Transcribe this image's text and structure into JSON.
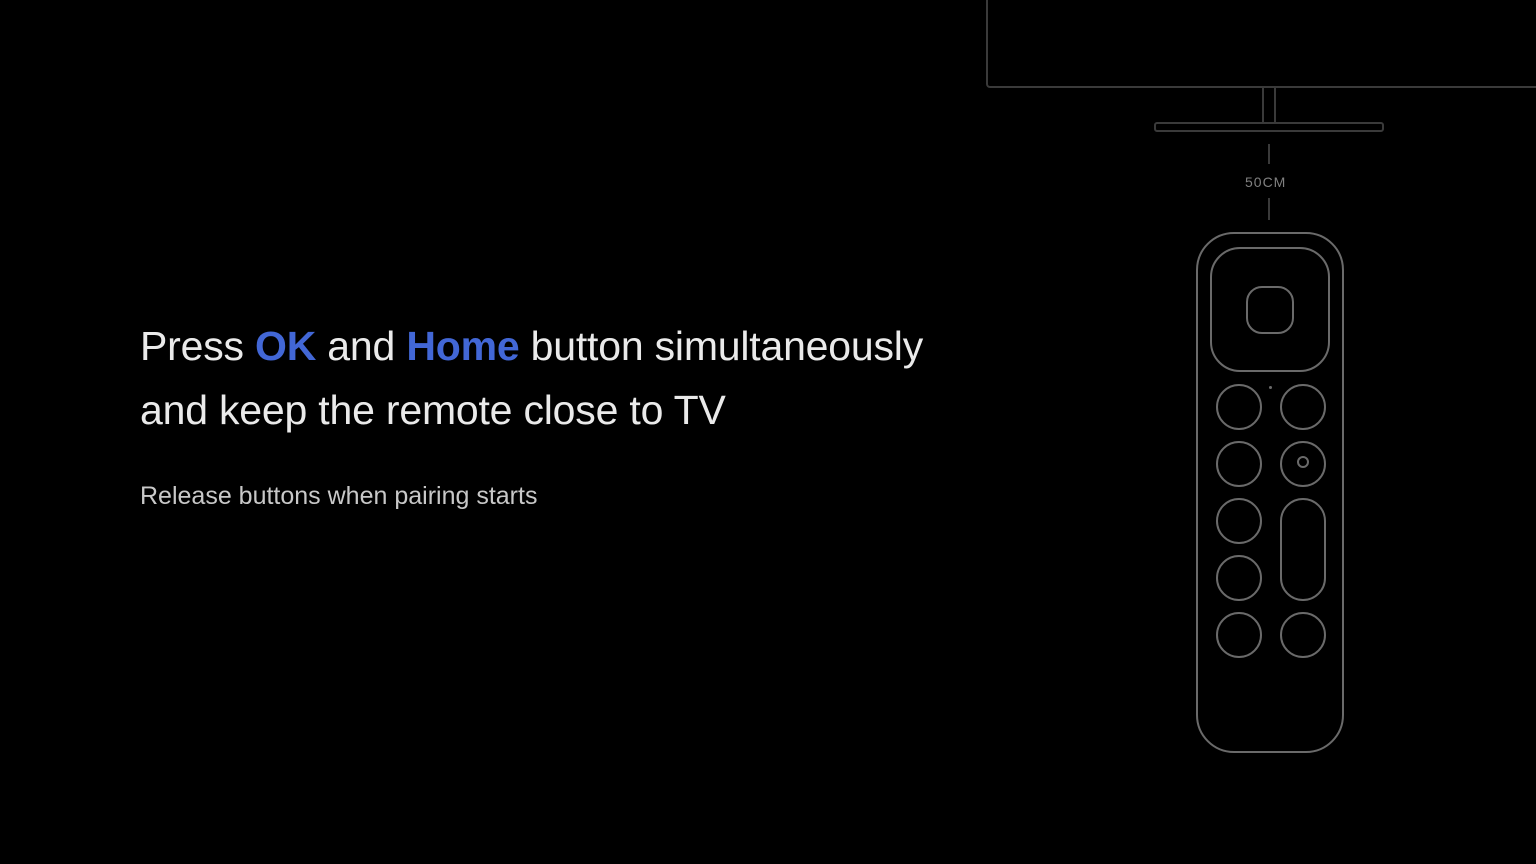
{
  "instruction": {
    "prefix": "Press ",
    "ok": "OK",
    "mid": " and ",
    "home": "Home",
    "suffix": " button simultaneously and keep the remote close to TV"
  },
  "sub": "Release buttons when pairing starts",
  "distance": "50CM"
}
